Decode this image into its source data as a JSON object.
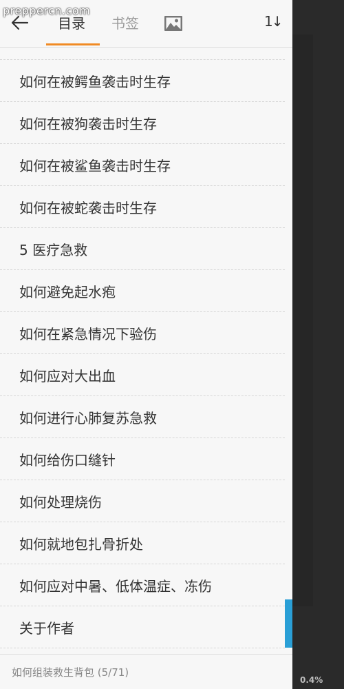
{
  "watermark": "preppercn.com",
  "header": {
    "tabs": [
      {
        "label": "目录",
        "active": true
      },
      {
        "label": "书签",
        "active": false
      }
    ],
    "icons": [
      "back-arrow-icon",
      "image-icon",
      "sort-icon"
    ],
    "sort_label": "1↓",
    "accent_color": "#f08a24"
  },
  "toc": {
    "items": [
      "如何在被鳄鱼袭击时生存",
      "如何在被狗袭击时生存",
      "如何在被鲨鱼袭击时生存",
      "如何在被蛇袭击时生存",
      "5 医疗急救",
      "如何避免起水疱",
      "如何在紧急情况下验伤",
      "如何应对大出血",
      "如何进行心肺复苏急救",
      "如何给伤口缝针",
      "如何处理烧伤",
      "如何就地包扎骨折处",
      "如何应对中暑、低体温症、冻伤",
      "关于作者"
    ]
  },
  "footer": {
    "current_chapter": "如何组装救生背包 (5/71)"
  },
  "reader": {
    "progress": "0.4%"
  },
  "scrollbar_color": "#2a9fd6"
}
